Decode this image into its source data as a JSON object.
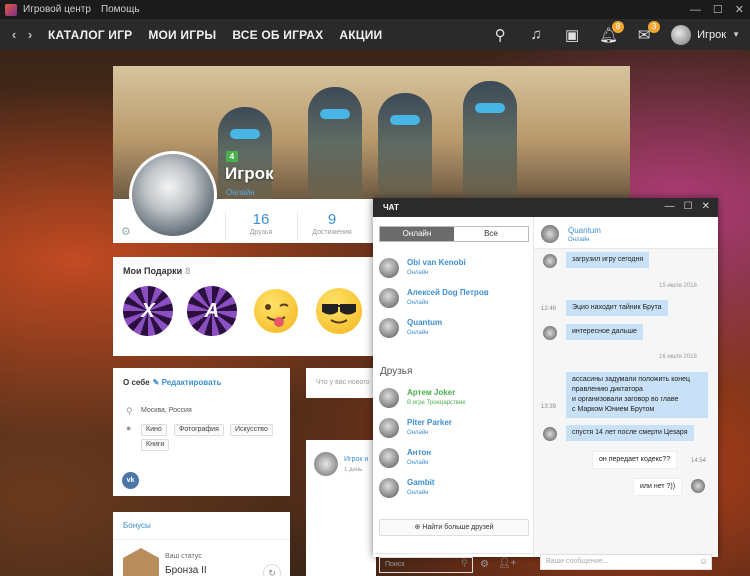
{
  "titlebar": {
    "menu": [
      "Игровой центр",
      "Помощь"
    ]
  },
  "nav": {
    "links": [
      "КАТАЛОГ ИГР",
      "МОИ ИГРЫ",
      "ВСЕ ОБ ИГРАХ",
      "АКЦИИ"
    ],
    "badge_notifications": "8",
    "badge_messages": "3",
    "user": "Игрок"
  },
  "profile": {
    "level": "4",
    "name": "Игрок",
    "status": "Онлайн",
    "stats": [
      {
        "num": "16",
        "label": "Друзья"
      },
      {
        "num": "9",
        "label": "Достижения"
      }
    ]
  },
  "gifts": {
    "title": "Мои Подарки",
    "count": "8",
    "letters": [
      "X",
      "A"
    ]
  },
  "about": {
    "title": "О себе",
    "edit": "Редактировать",
    "location": "Москва, Россия",
    "tags": [
      "Кино",
      "Фотография",
      "Искусство",
      "Книги"
    ]
  },
  "bonus": {
    "title": "Бонусы",
    "status_label": "Ваш статус",
    "rank": "Бронза II"
  },
  "feed": {
    "placeholder": "Что у вас нового",
    "author": "Игрок и",
    "date": "1 день"
  },
  "chat": {
    "title": "ЧАТ",
    "tabs": [
      "Онлайн",
      "Все"
    ],
    "online": [
      {
        "name": "Obi van Kenobi",
        "status": "Онлайн"
      },
      {
        "name": "Алексей Dog Петров",
        "status": "Онлайн"
      },
      {
        "name": "Quantum",
        "status": "Онлайн"
      }
    ],
    "friends_title": "Друзья",
    "friends": [
      {
        "name": "Артем Joker",
        "status": "В игре Троецарствие"
      },
      {
        "name": "Piter Parker",
        "status": "Онлайн"
      },
      {
        "name": "Антон",
        "status": "Онлайн"
      },
      {
        "name": "Gambit",
        "status": "Онлайн"
      }
    ],
    "more_friends": "Найти больше друзей",
    "search_placeholder": "Поиск",
    "peer": {
      "name": "Quantum",
      "status": "Онлайн"
    },
    "messages": {
      "m1": "загрузил игру сегодня",
      "date1": "15 июля 2018",
      "t1": "12:46",
      "m2": "Эцио находит тайник Брута",
      "m3": "интересное дальше",
      "date2": "16 июля 2018",
      "m4a": "ассасины задумали положить конец",
      "m4b": "правлению диктатора",
      "m4c": "и организовали заговор во главе",
      "m4d": "с Марком Юнием Брутом",
      "t2": "13:39",
      "m5": "спустя 14 лет после смерти Цезаря",
      "m6": "он передает кодекс??",
      "t3": "14:54",
      "m7": "или нет ?))"
    },
    "input_placeholder": "Ваше сообщение..."
  }
}
